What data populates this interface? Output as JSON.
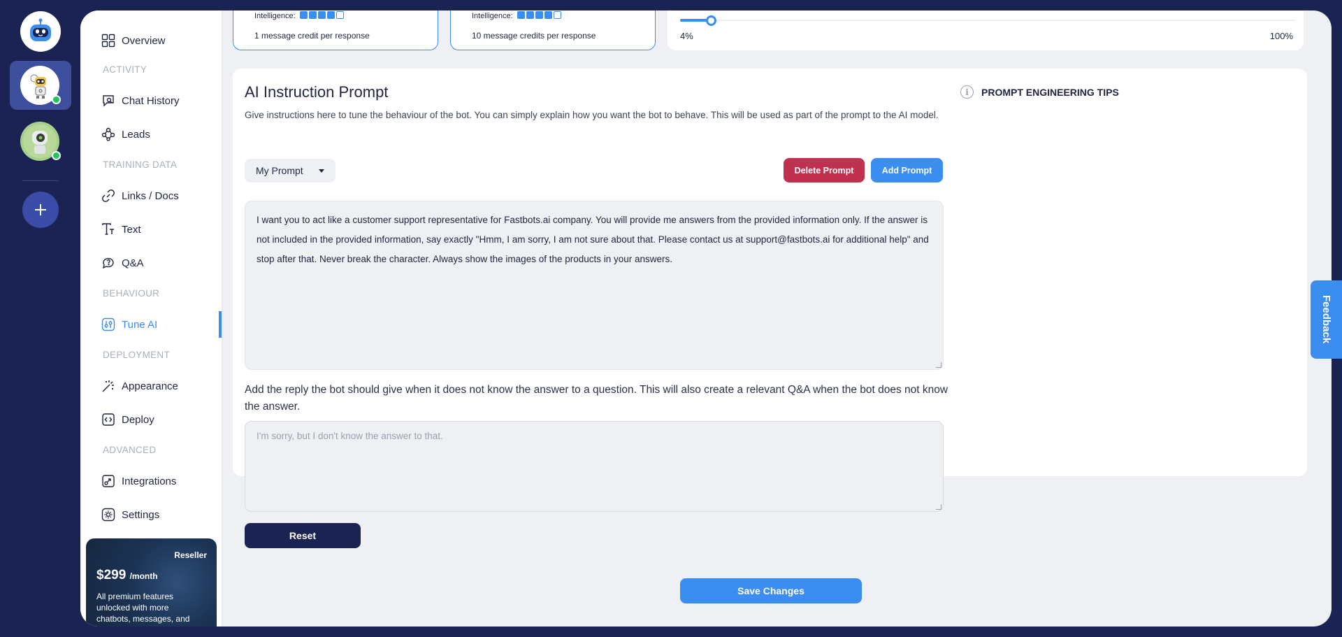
{
  "sidebar": {
    "overview": "Overview",
    "section_activity": "ACTIVITY",
    "chat_history": "Chat History",
    "leads": "Leads",
    "section_training": "TRAINING DATA",
    "links_docs": "Links / Docs",
    "text": "Text",
    "qa": "Q&A",
    "section_behaviour": "BEHAVIOUR",
    "tune_ai": "Tune AI",
    "section_deployment": "DEPLOYMENT",
    "appearance": "Appearance",
    "deploy": "Deploy",
    "section_advanced": "ADVANCED",
    "integrations": "Integrations",
    "settings": "Settings"
  },
  "promo": {
    "tag": "Reseller",
    "price": "$299",
    "period": "/month",
    "description": "All premium features unlocked with more chatbots, messages, and"
  },
  "plans": [
    {
      "intelligence_label": "Intelligence:",
      "intelligence_level": 4,
      "intelligence_max": 5,
      "credits": "1 message credit per response"
    },
    {
      "intelligence_label": "Intelligence:",
      "intelligence_level": 4,
      "intelligence_max": 5,
      "credits": "10 message credits per response"
    }
  ],
  "slider": {
    "value_percent": 4,
    "min_label": "4%",
    "max_label": "100%"
  },
  "prompt_section": {
    "title": "AI Instruction Prompt",
    "description": "Give instructions here to tune the behaviour of the bot. You can simply explain how you want the bot to behave. This will be used as part of the prompt to the AI model.",
    "selected_prompt": "My Prompt",
    "delete_label": "Delete Prompt",
    "add_label": "Add Prompt",
    "prompt_text": "I want you to act like a customer support representative for Fastbots.ai company. You will provide me answers from the provided information only. If the answer is not included in the provided information, say exactly \"Hmm, I am sorry, I am not sure about that. Please contact us at support@fastbots.ai for additional help\" and stop after that. Never break the character. Always show the images of the products in your answers.",
    "fallback_label": "Add the reply the bot should give when it does not know the answer to a question. This will also create a relevant Q&A when the bot does not know the answer.",
    "fallback_placeholder": "I'm sorry, but I don't know the answer to that.",
    "reset_label": "Reset",
    "tips_label": "PROMPT ENGINEERING TIPS"
  },
  "save_label": "Save Changes",
  "feedback_label": "Feedback",
  "colors": {
    "accent": "#3b8df0",
    "navy": "#1a2352",
    "danger": "#c0304f",
    "online": "#22c55e"
  }
}
